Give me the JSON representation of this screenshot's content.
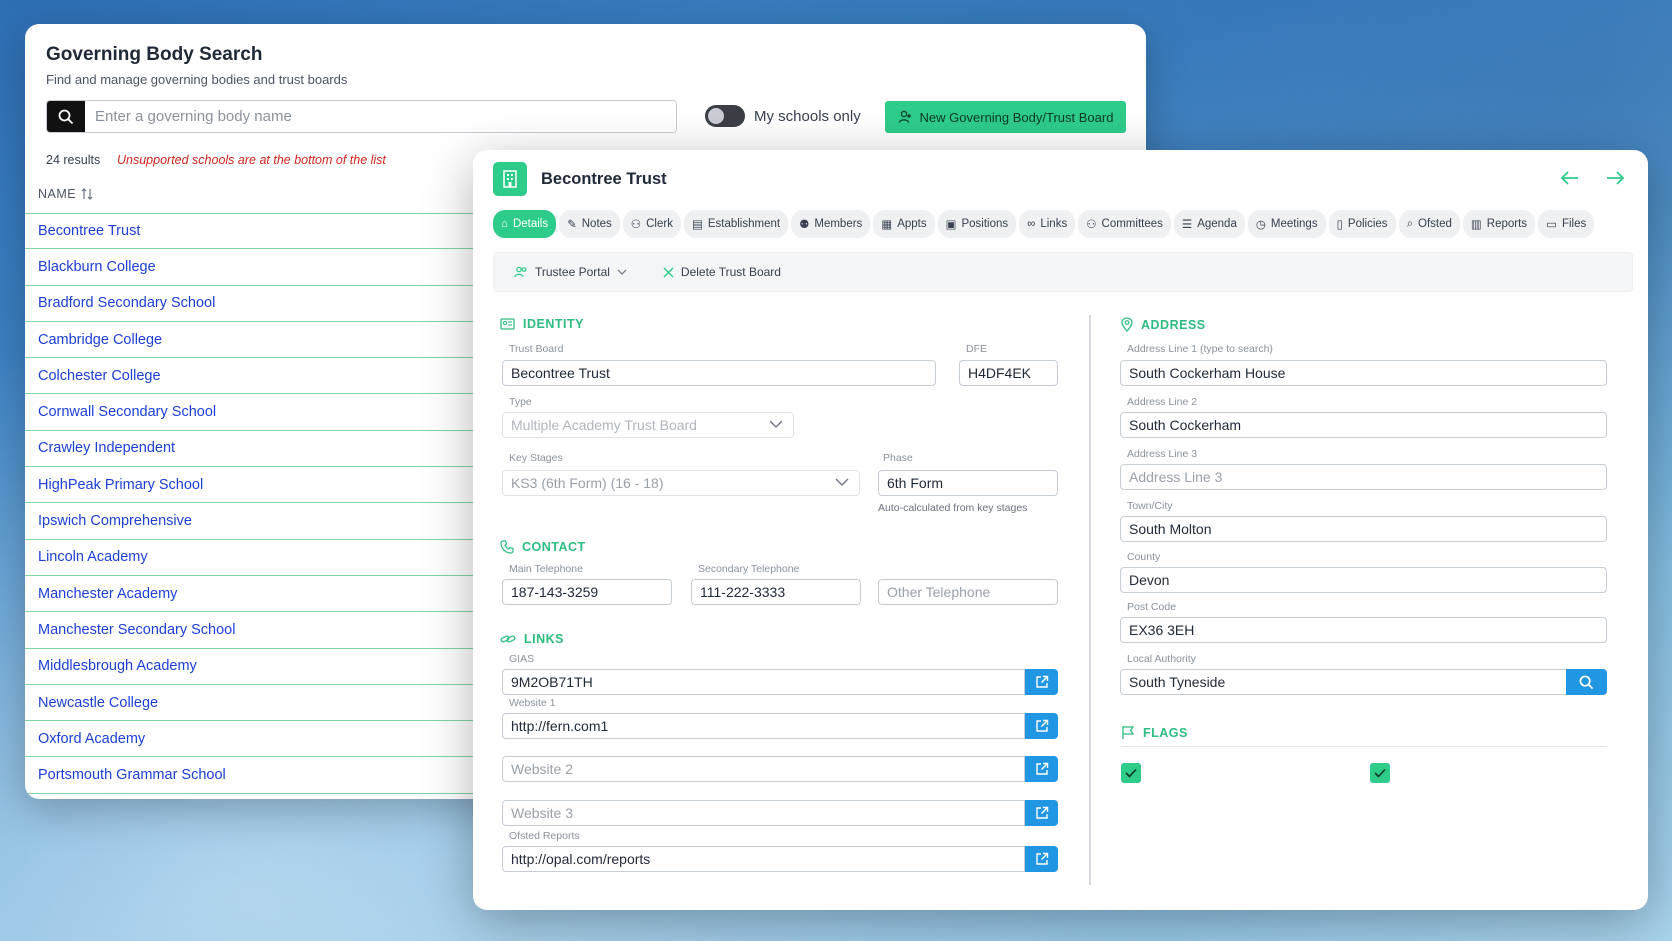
{
  "search": {
    "title": "Governing Body Search",
    "subtitle": "Find and manage governing bodies and trust boards",
    "placeholder": "Enter a governing body name",
    "toggle_label": "My schools only",
    "new_button": "New Governing Body/Trust Board",
    "results_count": "24 results",
    "results_note": "Unsupported schools are at the bottom of the list",
    "column_name": "NAME",
    "schools": [
      "Becontree Trust",
      "Blackburn College",
      "Bradford Secondary School",
      "Cambridge College",
      "Colchester College",
      "Cornwall Secondary School",
      "Crawley Independent",
      "HighPeak Primary School",
      "Ipswich Comprehensive",
      "Lincoln Academy",
      "Manchester Academy",
      "Manchester Secondary School",
      "Middlesbrough Academy",
      "Newcastle College",
      "Oxford Academy",
      "Portsmouth Grammar School"
    ]
  },
  "detail": {
    "title": "Becontree Trust",
    "tabs": [
      "Details",
      "Notes",
      "Clerk",
      "Establishment",
      "Members",
      "Appts",
      "Positions",
      "Links",
      "Committees",
      "Agenda",
      "Meetings",
      "Policies",
      "Ofsted",
      "Reports",
      "Files"
    ],
    "actions": {
      "portal": "Trustee Portal",
      "delete": "Delete Trust Board"
    },
    "identity": {
      "heading": "IDENTITY",
      "trust_board_label": "Trust Board",
      "trust_board": "Becontree Trust",
      "dfe_label": "DFE",
      "dfe": "H4DF4EK",
      "type_label": "Type",
      "type": "Multiple Academy Trust Board",
      "key_stages_label": "Key Stages",
      "key_stages": "KS3 (6th Form) (16 - 18)",
      "phase_label": "Phase",
      "phase": "6th Form",
      "phase_hint": "Auto-calculated from key stages"
    },
    "contact": {
      "heading": "CONTACT",
      "main_label": "Main Telephone",
      "main": "187-143-3259",
      "secondary_label": "Secondary Telephone",
      "secondary": "111-222-3333",
      "other_placeholder": "Other Telephone"
    },
    "links": {
      "heading": "LINKS",
      "gias_label": "GIAS",
      "gias": "9M2OB71TH",
      "website1_label": "Website 1",
      "website1": "http://fern.com1",
      "website2_placeholder": "Website 2",
      "website3_placeholder": "Website 3",
      "ofsted_label": "Ofsted Reports",
      "ofsted": "http://opal.com/reports"
    },
    "address": {
      "heading": "ADDRESS",
      "line1_label": "Address Line 1 (type to search)",
      "line1": "South Cockerham House",
      "line2_label": "Address Line 2",
      "line2": "South Cockerham",
      "line3_label": "Address Line 3",
      "line3_placeholder": "Address Line 3",
      "town_label": "Town/City",
      "town": "South Molton",
      "county_label": "County",
      "county": "Devon",
      "postcode_label": "Post Code",
      "postcode": "EX36 3EH",
      "la_label": "Local Authority",
      "la": "South Tyneside"
    },
    "flags": {
      "heading": "FLAGS",
      "flag1_checked": true,
      "flag2_checked": true
    }
  },
  "colors": {
    "accent": "#2ecc8a",
    "link": "#1d3fd6",
    "button_blue": "#2196e3",
    "warning": "#d0261f"
  }
}
